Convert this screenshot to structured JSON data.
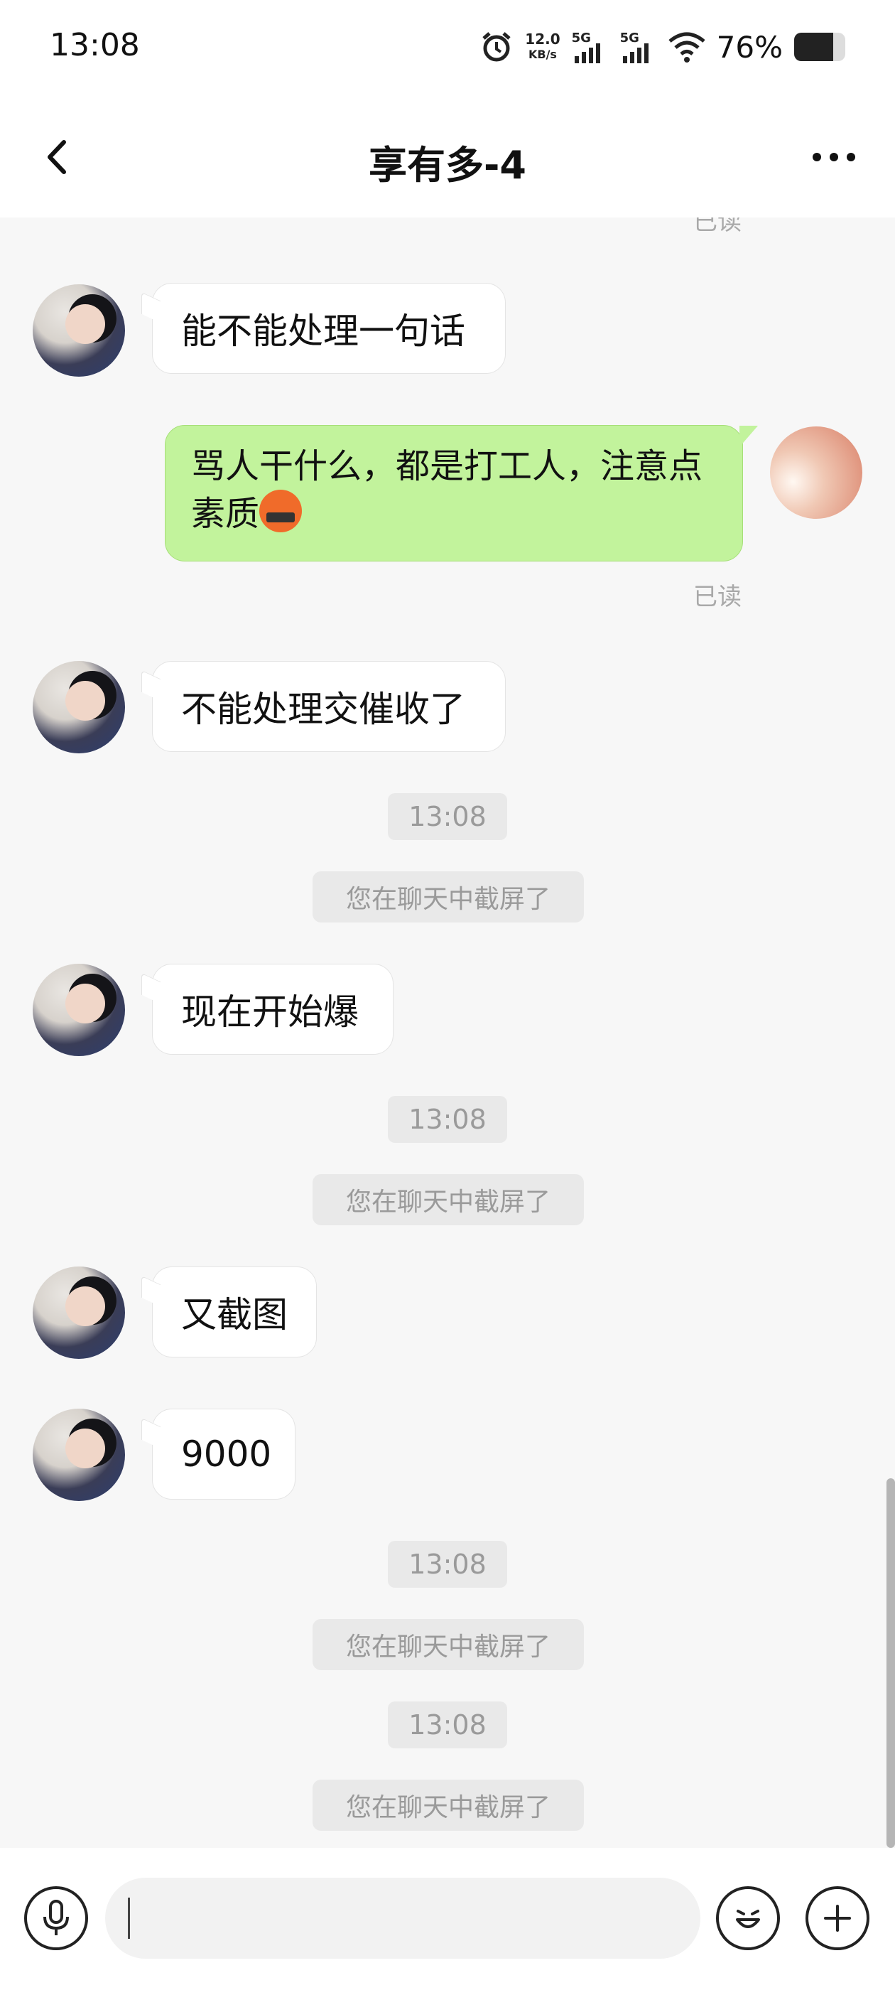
{
  "status_bar": {
    "time": "13:08",
    "net_speed_value": "12.0",
    "net_speed_unit": "KB/s",
    "signal1_label": "5G",
    "signal2_label": "5G",
    "battery": "76%"
  },
  "header": {
    "title": "享有多-4"
  },
  "messages": [
    {
      "id": "read0",
      "text": "已读"
    },
    {
      "id": "m1",
      "text": "能不能处理一句话"
    },
    {
      "id": "m2",
      "text": "骂人干什么，都是打工人，注意点素质"
    },
    {
      "id": "read1",
      "text": "已读"
    },
    {
      "id": "m3",
      "text": "不能处理交催收了"
    },
    {
      "id": "t1",
      "text": "13:08"
    },
    {
      "id": "n1",
      "text": "您在聊天中截屏了"
    },
    {
      "id": "m4",
      "text": "现在开始爆"
    },
    {
      "id": "t2",
      "text": "13:08"
    },
    {
      "id": "n2",
      "text": "您在聊天中截屏了"
    },
    {
      "id": "m5",
      "text": "又截图"
    },
    {
      "id": "m6",
      "text": "9000"
    },
    {
      "id": "t3",
      "text": "13:08"
    },
    {
      "id": "n3",
      "text": "您在聊天中截屏了"
    },
    {
      "id": "t4",
      "text": "13:08"
    },
    {
      "id": "n4",
      "text": "您在聊天中截屏了"
    }
  ],
  "icons": {
    "back": "chevron-left-icon",
    "more": "more-dots-icon",
    "voice": "microphone-icon",
    "emoji": "emoji-icon",
    "plus": "plus-icon",
    "inline_emoji": "swearing-face-emoji"
  },
  "colors": {
    "sent_bubble": "#c2f39c",
    "background": "#f7f7f7"
  }
}
